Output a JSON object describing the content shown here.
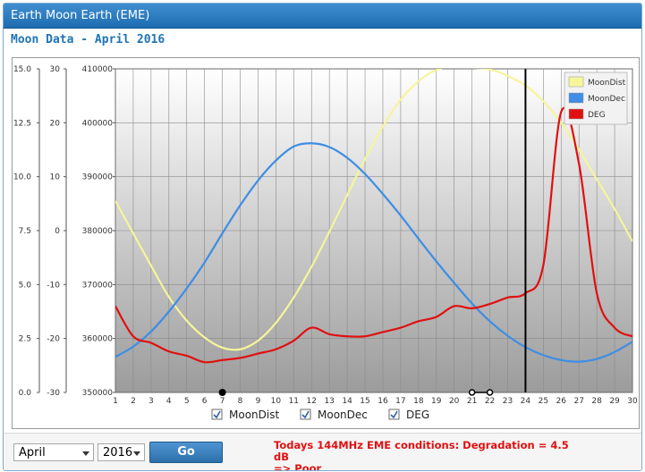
{
  "window": {
    "title": "Earth Moon Earth (EME)"
  },
  "page": {
    "subtitle": "Moon Data - April 2016"
  },
  "controls": {
    "month": "April",
    "year": "2016",
    "go_label": "Go",
    "status_line1": "Todays 144MHz EME conditions: Degradation = 4.5 dB",
    "status_line2": "=> Poor"
  },
  "checkboxes": [
    {
      "label": "MoonDist",
      "checked": true
    },
    {
      "label": "MoonDec",
      "checked": true
    },
    {
      "label": "DEG",
      "checked": true
    }
  ],
  "chart_data": {
    "type": "line",
    "title": "",
    "x": [
      1,
      2,
      3,
      4,
      5,
      6,
      7,
      8,
      9,
      10,
      11,
      12,
      13,
      14,
      15,
      16,
      17,
      18,
      19,
      20,
      21,
      22,
      23,
      24,
      25,
      26,
      27,
      28,
      29,
      30
    ],
    "xlim": [
      1,
      30
    ],
    "axes": {
      "deg": {
        "ticks": [
          "15.0",
          "12.5",
          "10.0",
          "7.5",
          "5.0",
          "2.5",
          "0.0"
        ],
        "range": [
          0,
          15
        ]
      },
      "dec": {
        "ticks": [
          "30",
          "20",
          "10",
          "0",
          "-10",
          "-20",
          "-30"
        ],
        "range": [
          -30,
          30
        ]
      },
      "dist": {
        "ticks": [
          "410000",
          "400000",
          "390000",
          "380000",
          "370000",
          "360000",
          "350000"
        ],
        "range": [
          350000,
          410000
        ]
      }
    },
    "grid": true,
    "legend_position": "top-right",
    "series": [
      {
        "name": "MoonDist",
        "color": "#f5f59a",
        "axis": "dist",
        "values": [
          385500,
          379500,
          373500,
          367700,
          363300,
          360200,
          358300,
          358000,
          359600,
          362900,
          367600,
          373300,
          379800,
          386600,
          393300,
          399300,
          404300,
          407700,
          409800,
          410500,
          410200,
          409900,
          408700,
          406900,
          404000,
          400000,
          395000,
          389500,
          384000,
          378000
        ]
      },
      {
        "name": "MoonDec",
        "color": "#3d8ee4",
        "axis": "dec",
        "values": [
          -23.4,
          -21.5,
          -18.7,
          -15,
          -10.7,
          -5.9,
          -0.5,
          4.7,
          9.3,
          13,
          15.6,
          16.2,
          15.5,
          13.5,
          10.5,
          6.8,
          2.8,
          -1.5,
          -5.7,
          -9.7,
          -13.5,
          -16.8,
          -19.5,
          -21.6,
          -23.1,
          -24,
          -24.3,
          -23.8,
          -22.5,
          -20.6
        ]
      },
      {
        "name": "DEG",
        "color": "#e01010",
        "axis": "deg",
        "values": [
          4.0,
          2.6,
          2.3,
          1.9,
          1.7,
          1.4,
          1.5,
          1.6,
          1.8,
          2.0,
          2.4,
          3.0,
          2.7,
          2.6,
          2.6,
          2.8,
          3.0,
          3.3,
          3.5,
          4.0,
          3.9,
          4.1,
          4.4,
          4.6,
          5.9,
          13.0,
          10.6,
          4.6,
          3.0,
          2.6
        ]
      }
    ],
    "markers": [
      {
        "x": 7,
        "style": "filled"
      },
      {
        "x": 21,
        "style": "open"
      },
      {
        "x": 22,
        "style": "open"
      }
    ],
    "current_day": 24
  }
}
